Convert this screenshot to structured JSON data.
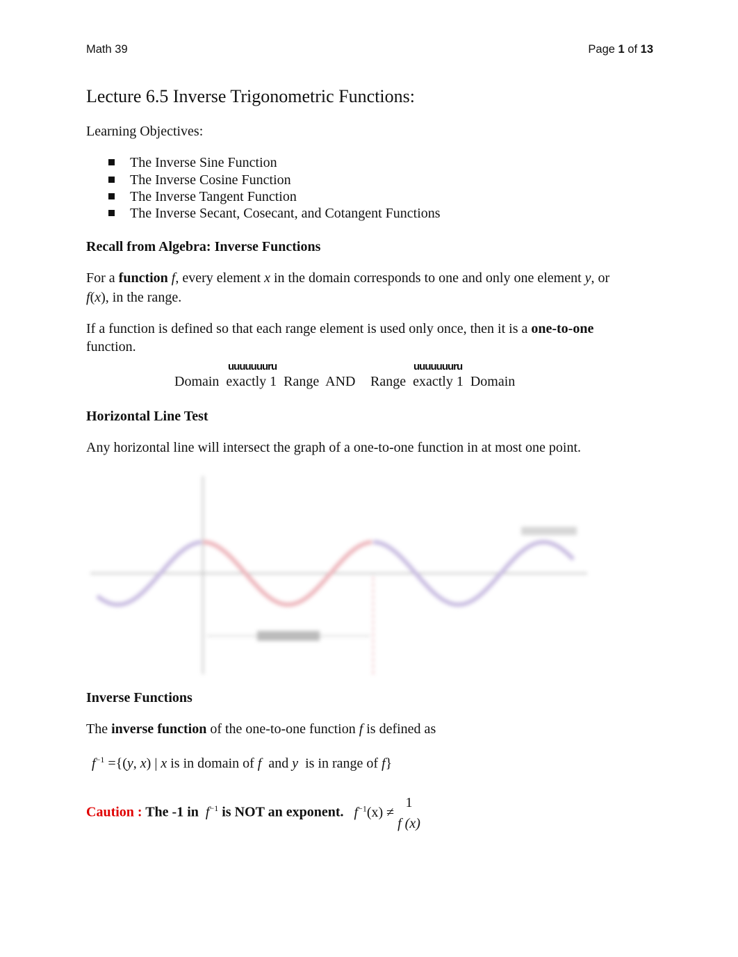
{
  "header": {
    "course": "Math 39",
    "page_prefix": "Page ",
    "page_current": "1",
    "page_of": " of ",
    "page_total": "13"
  },
  "title": "Lecture 6.5 Inverse Trigonometric Functions:",
  "objectives": {
    "heading": "Learning Objectives:",
    "items": [
      "The Inverse Sine Function",
      "The Inverse Cosine Function",
      "The Inverse Tangent Function",
      "The Inverse Secant, Cosecant, and Cotangent Functions"
    ]
  },
  "recall": {
    "heading": "Recall from Algebra:  Inverse Functions",
    "p1": {
      "a": "For a ",
      "b": "function",
      "c": " f",
      "d": ", every element ",
      "e": "x",
      "f": " in the domain corresponds to one and only one element ",
      "g": "y",
      "h": ", or",
      "i": "f",
      "j": "(",
      "k": "x",
      "l": "), in the range."
    },
    "p2": {
      "a": "If a function is defined so that each range element is used only once, then it is a ",
      "b": "one-to-one",
      "c": "function."
    },
    "brace": "uuuuuuuru",
    "rule_left": "Domain  exactly 1  Range  AND",
    "rule_right": "Range  exactly 1  Domain"
  },
  "hlt": {
    "heading": "Horizontal Line Test",
    "text": "Any horizontal line will intersect the graph of a one-to-one function in at most one point."
  },
  "graph": {
    "colors": {
      "restricted": "#e8a0a8",
      "rest": "#b8a8d8",
      "axis": "#999999"
    }
  },
  "inverse": {
    "heading": "Inverse Functions",
    "def": {
      "a": "The ",
      "b": "inverse function",
      "c": " of the one-to-one function ",
      "d": "f",
      "e": " is defined as"
    },
    "formula": {
      "f": "f",
      "sup": "−1",
      "eq": " ={(",
      "y": "y",
      ",": ", ",
      "x": "x",
      "bar": ") | ",
      "x2": "x",
      "t1": " is in domain of ",
      "f2": "f",
      "t2": "  and ",
      "y2": "y",
      "t3": "  is in range of ",
      "f3": "f",
      "close": "}"
    }
  },
  "caution": {
    "label": "Caution :",
    "text1": " The -1 in  ",
    "f": "f",
    "sup": "−1",
    "text2": " is NOT an exponent.",
    "lhs_f": "f",
    "lhs_sup": "−1",
    "lhs_x": "(x) ≠",
    "num": "1",
    "den": "f (x)"
  }
}
